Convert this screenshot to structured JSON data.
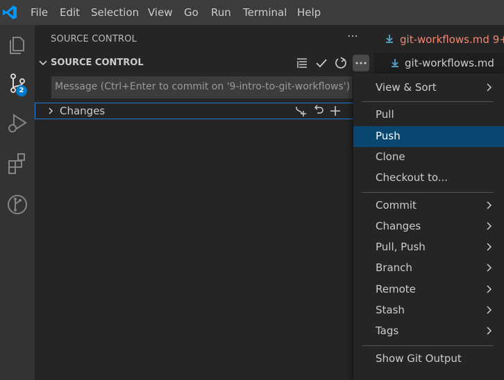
{
  "menubar": {
    "items": [
      "File",
      "Edit",
      "Selection",
      "View",
      "Go",
      "Run",
      "Terminal",
      "Help"
    ]
  },
  "activitybar": {
    "icons": [
      "explorer-icon",
      "source-control-icon",
      "run-debug-icon",
      "extensions-icon",
      "git-graph-icon"
    ],
    "scm_badge": "2",
    "accent_color": "#007acc"
  },
  "sidebar": {
    "title": "SOURCE CONTROL",
    "section_title": "SOURCE CONTROL",
    "commit_message_placeholder": "Message (Ctrl+Enter to commit on '9-intro-to-git-workflows')",
    "changes_label": "Changes"
  },
  "editor": {
    "tab_name": "git-workflows.md",
    "tab_suffix": "9+,",
    "breadcrumb_file": "git-workflows.md",
    "tab_color": "#f48771"
  },
  "context_menu": {
    "selected": "Push",
    "selected_color": "#094771",
    "groups": [
      [
        {
          "label": "View & Sort",
          "submenu": true
        }
      ],
      [
        {
          "label": "Pull",
          "submenu": false
        },
        {
          "label": "Push",
          "submenu": false
        },
        {
          "label": "Clone",
          "submenu": false
        },
        {
          "label": "Checkout to...",
          "submenu": false
        }
      ],
      [
        {
          "label": "Commit",
          "submenu": true
        },
        {
          "label": "Changes",
          "submenu": true
        },
        {
          "label": "Pull, Push",
          "submenu": true
        },
        {
          "label": "Branch",
          "submenu": true
        },
        {
          "label": "Remote",
          "submenu": true
        },
        {
          "label": "Stash",
          "submenu": true
        },
        {
          "label": "Tags",
          "submenu": true
        }
      ],
      [
        {
          "label": "Show Git Output",
          "submenu": false
        }
      ]
    ]
  }
}
